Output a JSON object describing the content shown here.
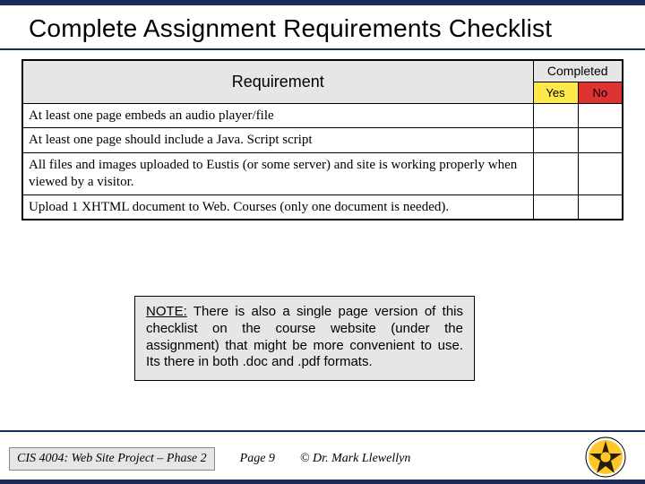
{
  "title": "Complete Assignment Requirements Checklist",
  "table": {
    "headers": {
      "requirement": "Requirement",
      "completed": "Completed",
      "yes": "Yes",
      "no": "No"
    },
    "rows": [
      "At least one page embeds an audio player/file",
      "At least one page should include a Java. Script script",
      "All files and images uploaded to Eustis (or some server) and site is working properly when viewed by a visitor.",
      "Upload 1 XHTML document to Web. Courses (only one document is needed)."
    ]
  },
  "note": {
    "label": "NOTE:",
    "text": "  There is also a single page version of this checklist on the course website (under the assignment) that might be more convenient to use. Its there in both .doc and .pdf formats."
  },
  "footer": {
    "course": "CIS 4004: Web Site Project – Phase 2",
    "page": "Page 9",
    "copyright": "© Dr. Mark Llewellyn"
  }
}
